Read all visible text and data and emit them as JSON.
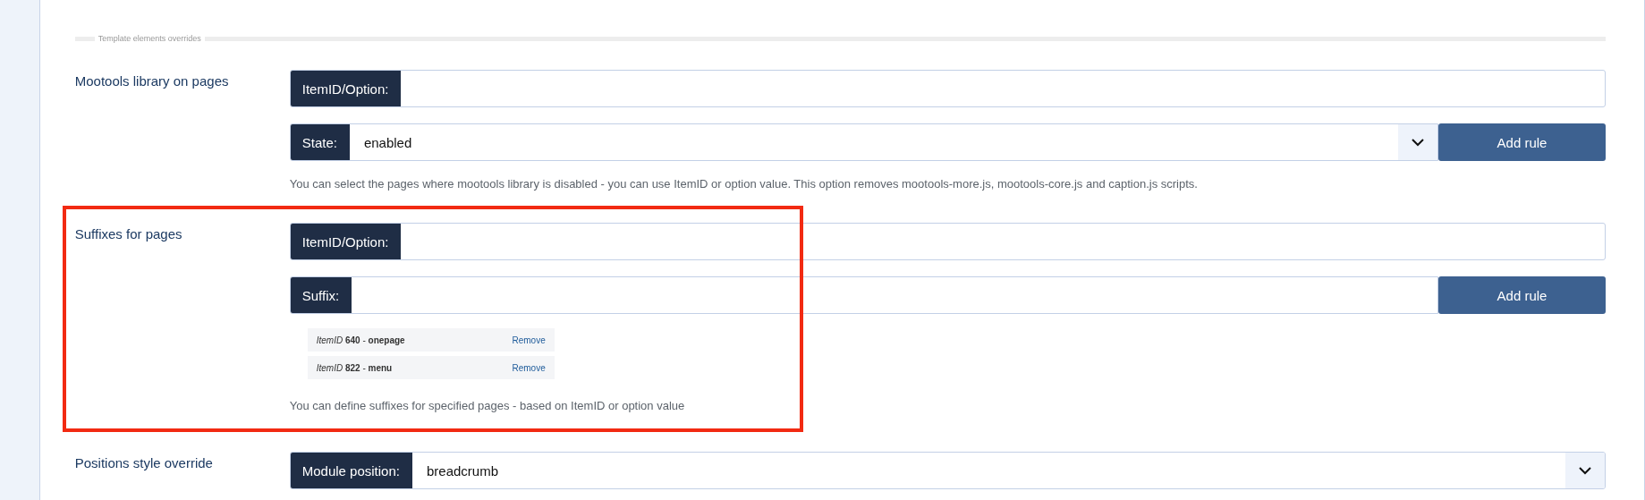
{
  "section_title": "Template elements overrides",
  "settings": [
    {
      "label": "Mootools library on pages",
      "highlighted": false,
      "fields": [
        {
          "kind": "text",
          "prefix": "ItemID/Option:"
        },
        {
          "kind": "select",
          "prefix": "State:",
          "value": "enabled",
          "add_button": "Add rule"
        }
      ],
      "help": "You can select the pages where mootools library is disabled - you can use ItemID or option value. This option removes mootools-more.js, mootools-core.js and caption.js scripts."
    },
    {
      "label": "Suffixes for pages",
      "highlighted": true,
      "fields": [
        {
          "kind": "text",
          "prefix": "ItemID/Option:"
        },
        {
          "kind": "text",
          "prefix": "Suffix:",
          "add_button": "Add rule"
        }
      ],
      "rules": [
        {
          "text": "*ItemID* **640** - **onepage**",
          "action": "Remove"
        },
        {
          "text": "*ItemID* **822** - **menu**",
          "action": "Remove"
        }
      ],
      "help": "You can define suffixes for specified pages - based on ItemID or option value"
    },
    {
      "label": "Positions style override",
      "highlighted": false,
      "fields": [
        {
          "kind": "select",
          "prefix": "Module position:",
          "value": "breadcrumb"
        }
      ]
    }
  ]
}
